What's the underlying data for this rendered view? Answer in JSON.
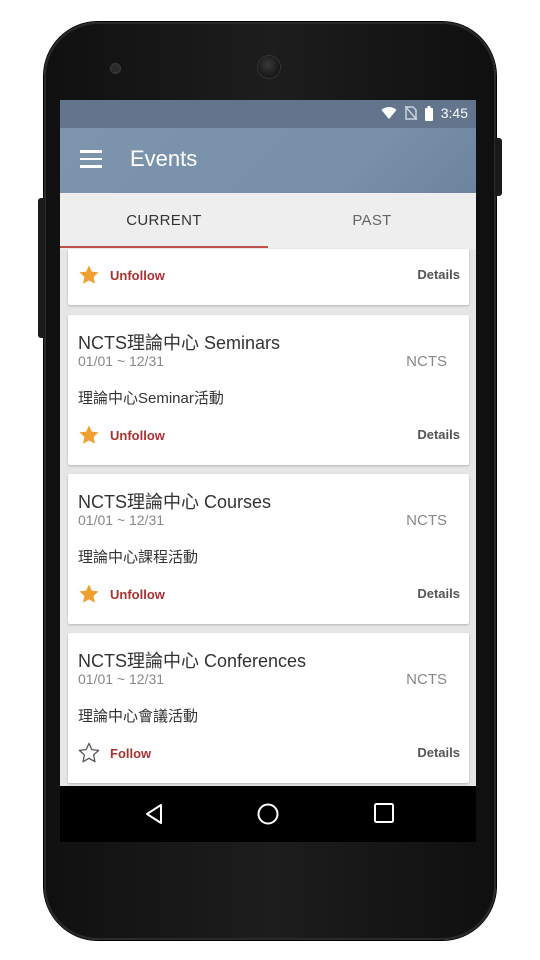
{
  "status_bar": {
    "time": "3:45"
  },
  "app_bar": {
    "title": "Events"
  },
  "tabs": [
    {
      "label": "CURRENT",
      "selected": true
    },
    {
      "label": "PAST",
      "selected": false
    }
  ],
  "accent_color": "#c0504d",
  "star_color": "#f0a030",
  "partial_card": {
    "follow_label": "Unfollow",
    "followed": true,
    "details_label": "Details"
  },
  "events": [
    {
      "title": "NCTS理論中心 Seminars",
      "dates": "01/01 ~ 12/31",
      "org": "NCTS",
      "description": "理論中心Seminar活動",
      "follow_label": "Unfollow",
      "followed": true,
      "details_label": "Details"
    },
    {
      "title": "NCTS理論中心 Courses",
      "dates": "01/01 ~ 12/31",
      "org": "NCTS",
      "description": "理論中心課程活動",
      "follow_label": "Unfollow",
      "followed": true,
      "details_label": "Details"
    },
    {
      "title": "NCTS理論中心 Conferences",
      "dates": "01/01 ~ 12/31",
      "org": "NCTS",
      "description": "理論中心會議活動",
      "follow_label": "Follow",
      "followed": false,
      "details_label": "Details"
    }
  ],
  "nav": {
    "back": "back-icon",
    "home": "home-icon",
    "recents": "recents-icon"
  }
}
